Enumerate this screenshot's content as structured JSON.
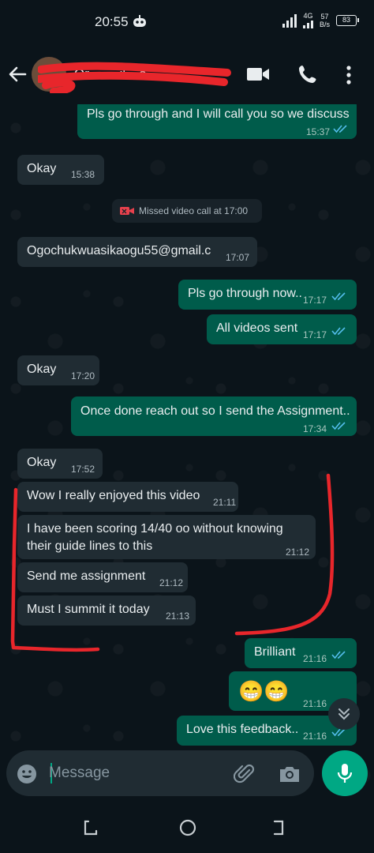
{
  "status_bar": {
    "time": "20:55",
    "network": "4G",
    "speed_value": "57",
    "speed_unit": "B/s",
    "battery": "83"
  },
  "header": {
    "contact_name": "Or··· ···il···o...",
    "icons": [
      "back-arrow-icon",
      "video-call-icon",
      "phone-icon",
      "more-options-icon"
    ]
  },
  "messages": [
    {
      "dir": "out",
      "text": "Pls go through and I will call you so we discuss",
      "time": "15:37",
      "read": true
    },
    {
      "dir": "in",
      "text": "Okay",
      "time": "15:38"
    },
    {
      "dir": "system",
      "text": "Missed video call at 17:00"
    },
    {
      "dir": "in",
      "text": "Ogochukwuasikaogu55@gmail.c",
      "time": "17:07"
    },
    {
      "dir": "out",
      "text": "Pls go through now..",
      "time": "17:17",
      "read": true
    },
    {
      "dir": "out",
      "text": "All videos sent",
      "time": "17:17",
      "read": true
    },
    {
      "dir": "in",
      "text": "Okay",
      "time": "17:20"
    },
    {
      "dir": "out",
      "text": "Once done reach out so I send the Assignment..",
      "time": "17:34",
      "read": true
    },
    {
      "dir": "in",
      "text": "Okay",
      "time": "17:52"
    },
    {
      "dir": "in",
      "text": "Wow I really enjoyed this video",
      "time": "21:11"
    },
    {
      "dir": "in",
      "text_line1": "I have been scoring 14/40 oo without knowing",
      "text_line2": "their guide lines to this",
      "time": "21:12"
    },
    {
      "dir": "in",
      "text": "Send me assignment",
      "time": "21:12"
    },
    {
      "dir": "in",
      "text": "Must I summit it today",
      "time": "21:13"
    },
    {
      "dir": "out",
      "text": "Brilliant",
      "time": "21:16",
      "read": true
    },
    {
      "dir": "out",
      "text": "😁😁",
      "time": "21:16",
      "read": false
    },
    {
      "dir": "out",
      "text": "Love this feedback..",
      "time": "21:16",
      "read": true
    }
  ],
  "input": {
    "placeholder": "Message"
  },
  "colors": {
    "background": "#0b141a",
    "incoming_bubble": "#202c33",
    "outgoing_bubble": "#005c4b",
    "accent": "#00a884",
    "read_ticks": "#53bdeb",
    "annotation_red": "#e8262b"
  }
}
